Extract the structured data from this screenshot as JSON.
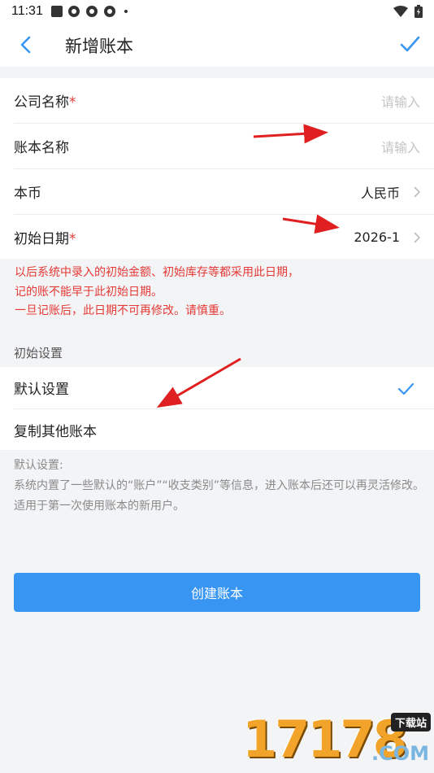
{
  "status": {
    "time": "11:31"
  },
  "header": {
    "title": "新增账本"
  },
  "form": {
    "company": {
      "label": "公司名称",
      "required_mark": "*",
      "placeholder": "请输入"
    },
    "ledger": {
      "label": "账本名称",
      "placeholder": "请输入"
    },
    "currency": {
      "label": "本币",
      "value": "人民币"
    },
    "start_date": {
      "label": "初始日期",
      "required_mark": "*",
      "value": "2026-1"
    }
  },
  "warning_lines": [
    "以后系统中录入的初始金额、初始库存等都采用此日期，",
    "记的账不能早于此初始日期。",
    "一旦记账后，此日期不可再修改。请慎重。"
  ],
  "settings": {
    "section_title": "初始设置",
    "options": [
      {
        "label": "默认设置",
        "selected": true
      },
      {
        "label": "复制其他账本",
        "selected": false
      }
    ]
  },
  "description": {
    "heading": "默认设置:",
    "line1": "系统内置了一些默认的“账户”“收支类别”等信息，进入账本后还可以再灵活修改。",
    "line2": "适用于第一次使用账本的新用户。"
  },
  "create_button": "创建账本",
  "watermark": {
    "digits": "17178",
    "badge": "下载站",
    "suffix": ".COM"
  },
  "colors": {
    "accent": "#3896f2",
    "warning": "#e53935",
    "arrow": "#e02020"
  }
}
